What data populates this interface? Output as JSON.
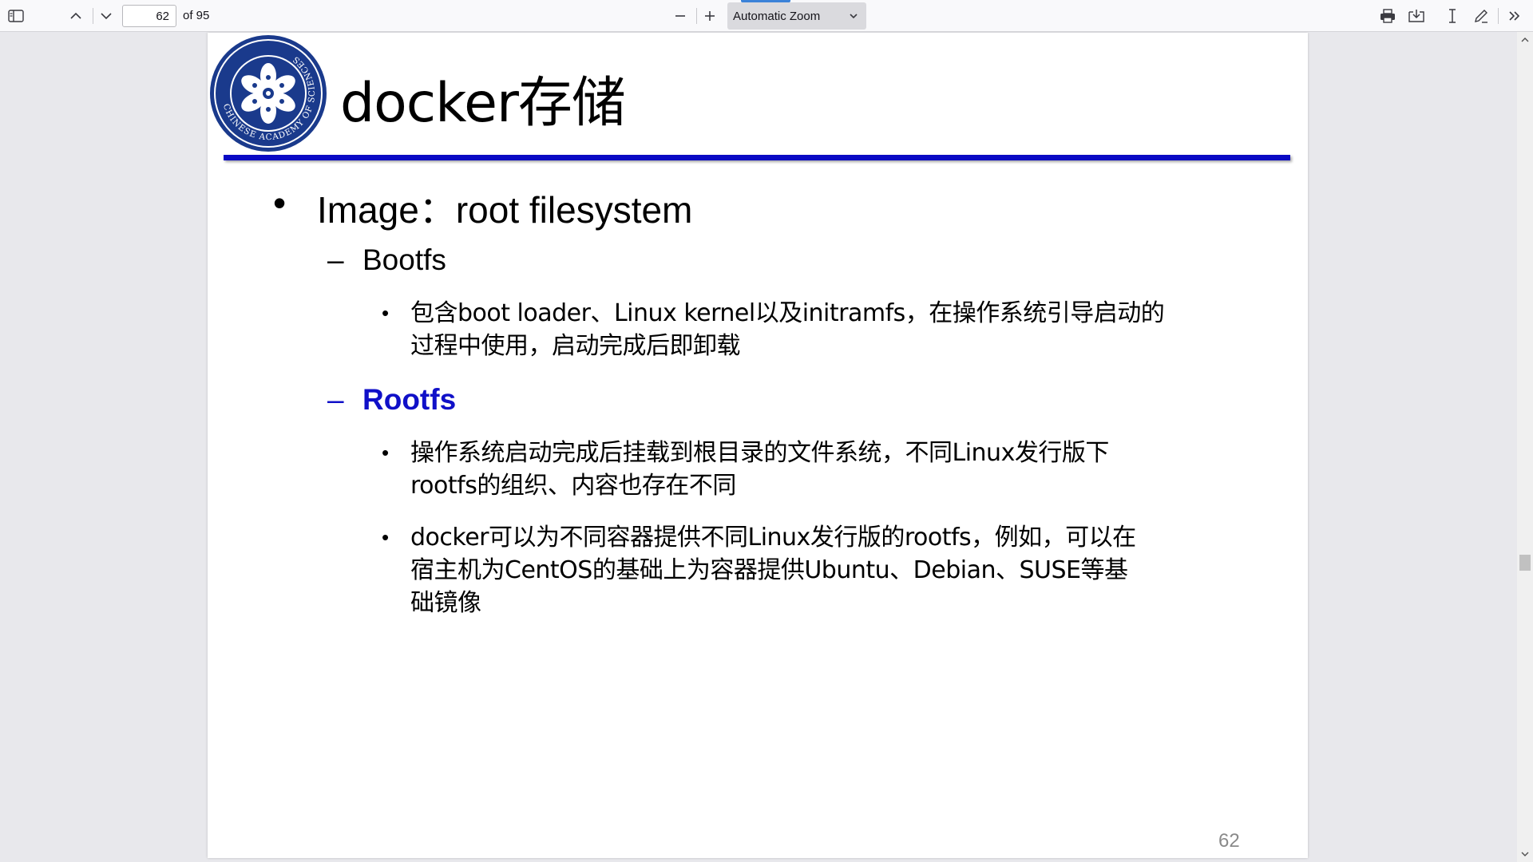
{
  "toolbar": {
    "sidebar_toggle_icon": "sidebar-toggle-icon",
    "prev_page_icon": "chevron-up-icon",
    "next_page_icon": "chevron-down-icon",
    "page_number": "62",
    "page_count": "of 95",
    "zoom_out_icon": "minus-icon",
    "zoom_in_icon": "plus-icon",
    "zoom_value": "Automatic Zoom",
    "print_icon": "print-icon",
    "save_icon": "download-icon",
    "text_select_icon": "text-cursor-icon",
    "draw_icon": "pen-icon",
    "more_tools_icon": "double-chevron-right-icon"
  },
  "slide": {
    "title": "docker存储",
    "logo_label": "CHINESE ACADEMY OF SCIENCES",
    "bullet1": "Image：root filesystem",
    "bullet1_dot": "•",
    "dash": "–",
    "sub1": "Bootfs",
    "sub1_item1_line1": "包含boot loader、Linux kernel以及initramfs，在操作系统引导启动的",
    "sub1_item1_line2": "过程中使用，启动完成后即卸载",
    "sub2": "Rootfs",
    "sub2_item1_line1": "操作系统启动完成后挂载到根目录的文件系统，不同Linux发行版下",
    "sub2_item1_line2": "rootfs的组织、内容也存在不同",
    "sub2_item2_line1": "docker可以为不同容器提供不同Linux发行版的rootfs，例如，可以在",
    "sub2_item2_line2": "宿主机为CentOS的基础上为容器提供Ubuntu、Debian、SUSE等基",
    "sub2_item2_line3": "础镜像",
    "page_number": "62"
  },
  "colors": {
    "title_rule": "#0a0ac4",
    "highlight_heading": "#1010c8",
    "logo_blue": "#1a3a8c"
  }
}
